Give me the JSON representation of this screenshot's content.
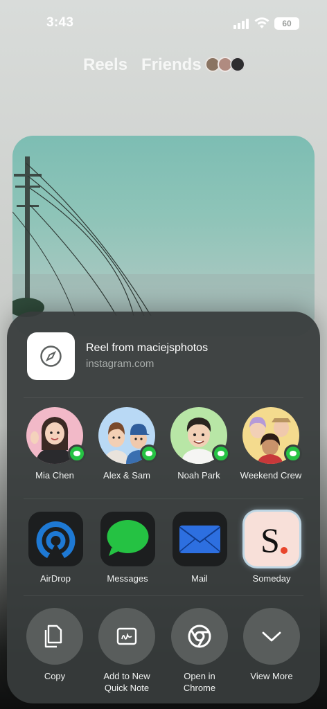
{
  "status": {
    "time": "3:43",
    "battery": "60"
  },
  "header": {
    "tabs": [
      "Reels",
      "Friends"
    ]
  },
  "share": {
    "title": "Reel from maciejsphotos",
    "subtitle": "instagram.com",
    "contacts": [
      {
        "name": "Mia Chen",
        "color": "#f2b9c8"
      },
      {
        "name": "Alex & Sam",
        "color": "#b9d9f5"
      },
      {
        "name": "Noah Park",
        "color": "#b8e6a6"
      },
      {
        "name": "Weekend Crew",
        "color": "#f4db8e"
      }
    ],
    "apps": [
      {
        "label": "AirDrop",
        "icon": "airdrop-icon"
      },
      {
        "label": "Messages",
        "icon": "messages-icon"
      },
      {
        "label": "Mail",
        "icon": "mail-icon"
      },
      {
        "label": "Someday",
        "icon": "someday-icon"
      }
    ],
    "actions": [
      {
        "label": "Copy",
        "icon": "copy-icon"
      },
      {
        "label": "Add to New\nQuick Note",
        "icon": "quick-note-icon"
      },
      {
        "label": "Open in\nChrome",
        "icon": "chrome-icon"
      },
      {
        "label": "View More",
        "icon": "chevron-down-icon"
      }
    ]
  },
  "colors": {
    "messages_green": "#25c243",
    "sheet": "#373c3b",
    "someday_red": "#e8452c"
  }
}
